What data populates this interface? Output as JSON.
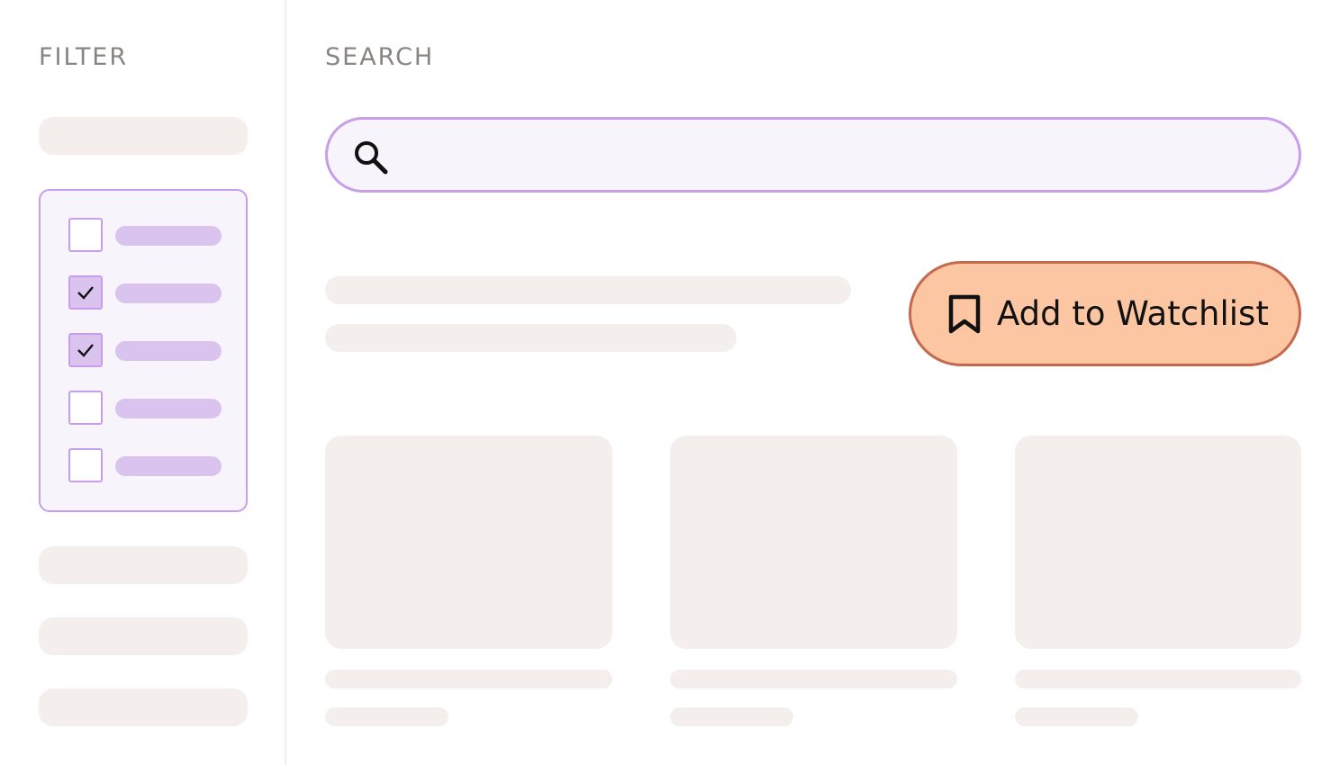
{
  "sidebar": {
    "title": "FILTER",
    "options": [
      {
        "checked": false
      },
      {
        "checked": true
      },
      {
        "checked": true
      },
      {
        "checked": false
      },
      {
        "checked": false
      }
    ]
  },
  "main": {
    "title": "SEARCH",
    "search": {
      "placeholder": "",
      "value": ""
    },
    "watchlist_button": {
      "label": "Add to Watchlist",
      "icon": "bookmark-icon"
    }
  },
  "colors": {
    "accent_purple": "#c99ee8",
    "button_fill": "#fdc6a2",
    "button_border": "#c4694e",
    "skeleton": "#f4efed"
  }
}
